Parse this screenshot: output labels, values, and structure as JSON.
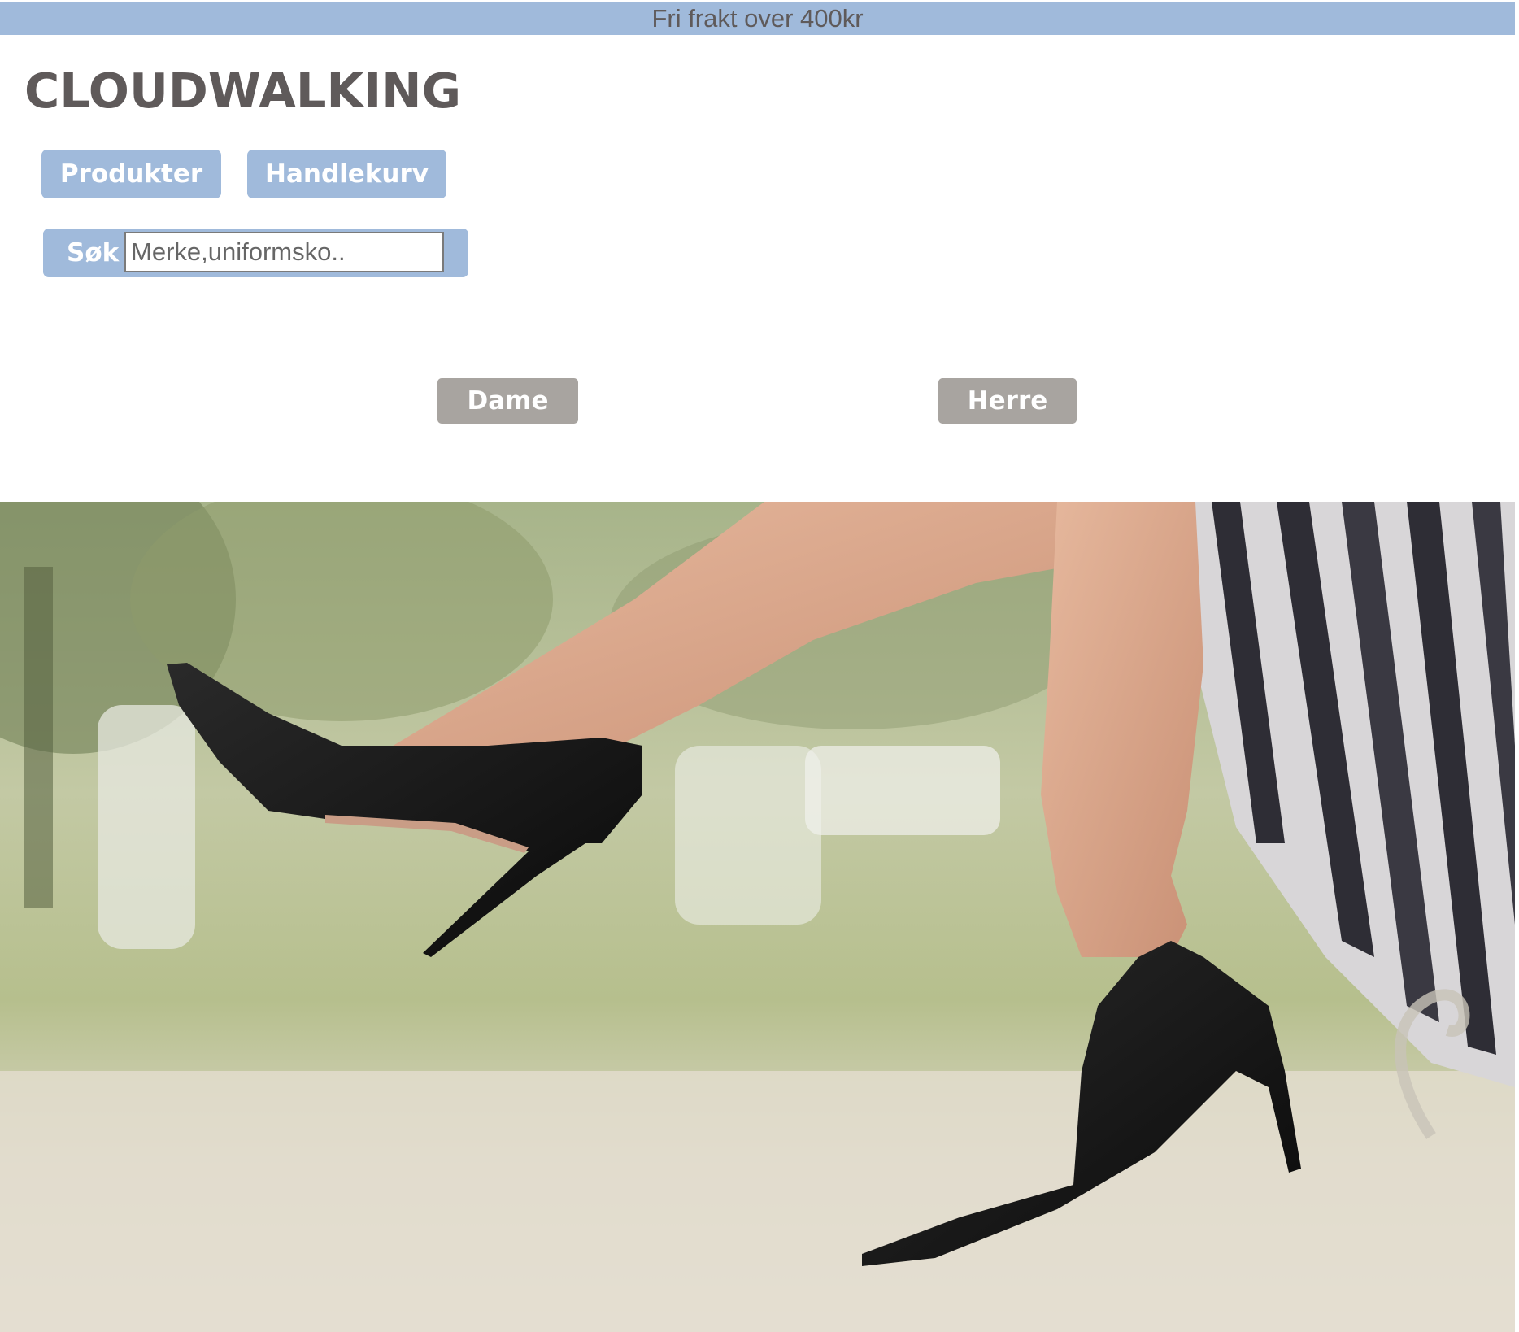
{
  "banner": {
    "text": "Fri frakt over 400kr"
  },
  "header": {
    "logo": "CLOUDWALKING"
  },
  "nav": {
    "items": [
      {
        "label": "Produkter"
      },
      {
        "label": "Handlekurv"
      }
    ]
  },
  "search": {
    "label": "Søk",
    "placeholder": "Merke,uniformsko..",
    "value": ""
  },
  "categories": [
    {
      "label": "Dame"
    },
    {
      "label": "Herre"
    }
  ],
  "colors": {
    "accent": "#a0badb",
    "text": "#5f5a5a",
    "category_button": "#a8a4a0"
  }
}
